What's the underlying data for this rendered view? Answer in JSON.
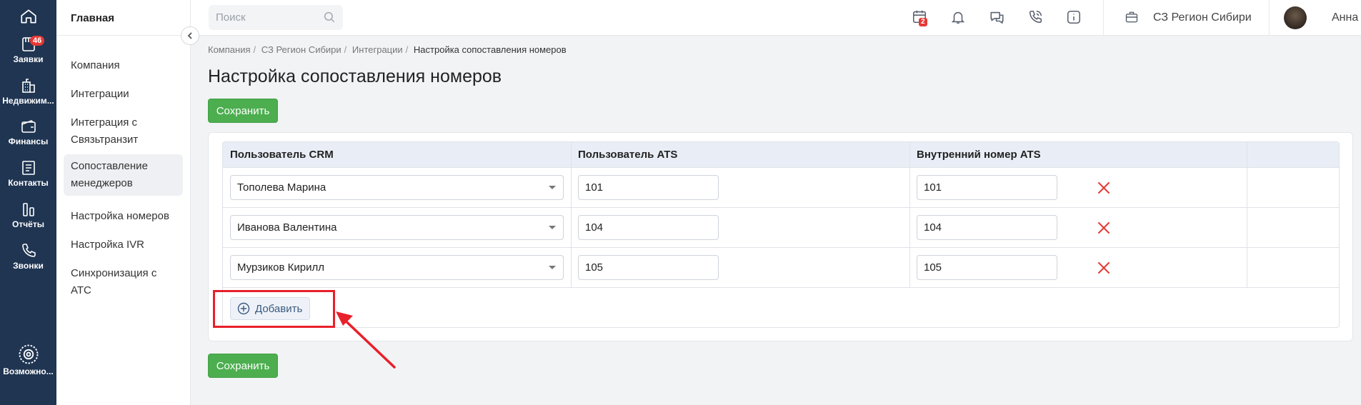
{
  "rail": {
    "items": [
      {
        "label": "",
        "icon": "home-icon"
      },
      {
        "label": "Заявки",
        "icon": "requests-icon",
        "badge": "46"
      },
      {
        "label": "Недвижим...",
        "icon": "building-icon"
      },
      {
        "label": "Финансы",
        "icon": "wallet-icon"
      },
      {
        "label": "Контакты",
        "icon": "contacts-icon"
      },
      {
        "label": "Отчёты",
        "icon": "reports-icon"
      },
      {
        "label": "Звонки",
        "icon": "phone-icon"
      },
      {
        "label": "Возможно...",
        "icon": "gear-icon"
      }
    ]
  },
  "sidebar": {
    "title": "Главная",
    "items": [
      {
        "label": "Компания"
      },
      {
        "label": "Интеграции"
      },
      {
        "label": "Интеграция с Связьтранзит"
      },
      {
        "label": "Сопоставление менеджеров",
        "active": true
      },
      {
        "label": "Настройка номеров"
      },
      {
        "label": "Настройка IVR"
      },
      {
        "label": "Синхронизация с АТС"
      }
    ]
  },
  "topbar": {
    "search_placeholder": "Поиск",
    "calendar_badge": "2",
    "company": "СЗ Регион Сибири",
    "user": "Анна Е."
  },
  "breadcrumb": [
    "Компания",
    "СЗ Регион Сибири",
    "Интеграции",
    "Настройка сопоставления номеров"
  ],
  "page": {
    "title": "Настройка сопоставления номеров",
    "save_label": "Сохранить",
    "add_label": "Добавить"
  },
  "table": {
    "columns": [
      "Пользователь CRM",
      "Пользователь ATS",
      "Внутренний номер ATS",
      ""
    ],
    "rows": [
      {
        "crm_user": "Тополева Марина",
        "ats_user": "101",
        "ats_ext": "101"
      },
      {
        "crm_user": "Иванова Валентина",
        "ats_user": "104",
        "ats_ext": "104"
      },
      {
        "crm_user": "Мурзиков Кирилл",
        "ats_user": "105",
        "ats_ext": "105"
      }
    ]
  },
  "colors": {
    "rail_bg": "#1f3552",
    "save_green": "#4cae4f",
    "delete_red": "#e53935",
    "highlight_red": "#e8202a"
  }
}
